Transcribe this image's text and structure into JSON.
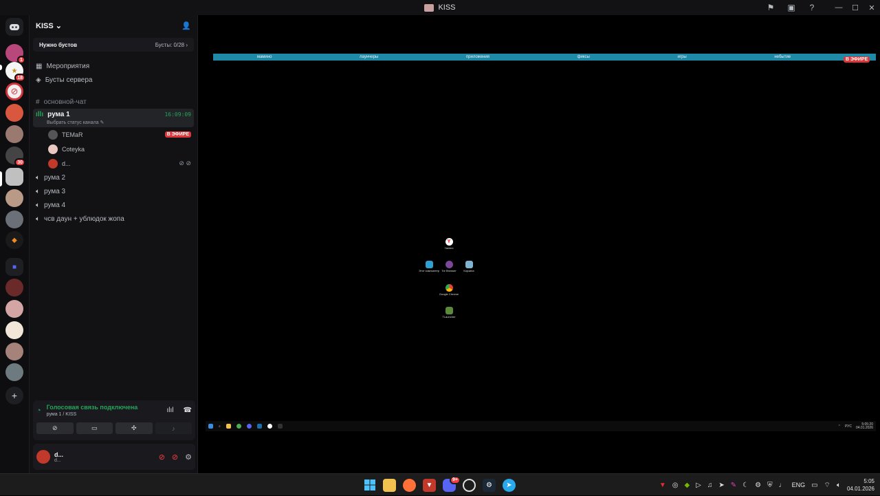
{
  "window": {
    "title": "KISS"
  },
  "server": {
    "name": "KISS",
    "boost_label": "Нужно бустов",
    "boost_count": "Бусты: 0/28",
    "nav": [
      {
        "label": "Мероприятия"
      },
      {
        "label": "Бусты сервера"
      }
    ],
    "text_channel": "основной-чат",
    "active_voice": {
      "name": "рума 1",
      "time": "16:09:09",
      "status": "Выбрать статус канала",
      "users": [
        {
          "name": "TEMaR",
          "badge": "В ЭФИРЕ"
        },
        {
          "name": "Coteyka",
          "badge": ""
        },
        {
          "name": "d...",
          "badge": ""
        }
      ]
    },
    "voice_channels": [
      {
        "name": "рума 2"
      },
      {
        "name": "рума 3"
      },
      {
        "name": "рума 4"
      },
      {
        "name": "чсв даун + ублюдок жопа"
      }
    ]
  },
  "guild_badges": [
    "1",
    "18",
    "30"
  ],
  "voice_panel": {
    "title": "Голосовая связь подключена",
    "subtitle": "рума 1 / KISS"
  },
  "user": {
    "name": "d...",
    "status": "d..."
  },
  "stream": {
    "live_badge": "В ЭФИРЕ",
    "bar_items": [
      "мамино",
      "лаунчеры",
      "приложения",
      "фиксы",
      "игры",
      "небытие"
    ],
    "desktop_icons": [
      {
        "label": "Yandex"
      },
      {
        "label": "Этот компьютер"
      },
      {
        "label": "Tor Browser"
      },
      {
        "label": "Корзина"
      },
      {
        "label": "Google Chrome"
      },
      {
        "label": "TLauncher"
      }
    ],
    "remote_tray": {
      "lang": "РУС",
      "time": "5:05:20",
      "date": "04.01.2026"
    }
  },
  "taskbar": {
    "discord_badge": "9+",
    "lang": "ENG",
    "time": "5:05",
    "date": "04.01.2026"
  }
}
